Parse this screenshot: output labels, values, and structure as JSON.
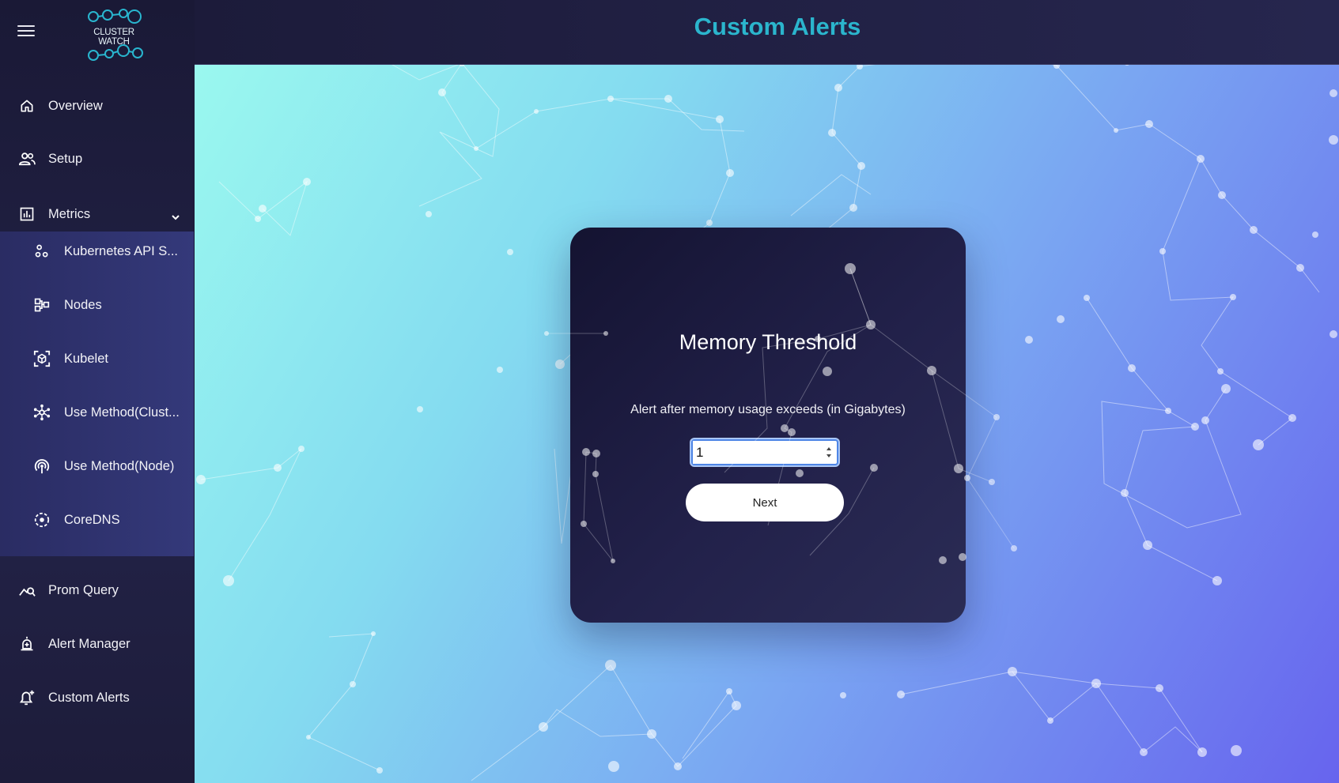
{
  "app": {
    "logo_text": "CLUSTER WATCH",
    "page_title": "Custom Alerts"
  },
  "sidebar": {
    "items": [
      {
        "label": "Overview",
        "icon": "home-icon"
      },
      {
        "label": "Setup",
        "icon": "users-icon"
      },
      {
        "label": "Metrics",
        "icon": "bar-chart-icon"
      },
      {
        "label": "Prom Query",
        "icon": "query-chart-icon"
      },
      {
        "label": "Alert Manager",
        "icon": "alarm-icon"
      },
      {
        "label": "Custom Alerts",
        "icon": "add-alert-icon"
      }
    ],
    "metrics_sub": [
      {
        "label": "Kubernetes API S...",
        "icon": "hub-icon"
      },
      {
        "label": "Nodes",
        "icon": "schema-icon"
      },
      {
        "label": "Kubelet",
        "icon": "cube-scan-icon"
      },
      {
        "label": "Use Method(Clust...",
        "icon": "network-hub-icon"
      },
      {
        "label": "Use Method(Node)",
        "icon": "wireless-icon"
      },
      {
        "label": "CoreDNS",
        "icon": "dashed-circle-icon"
      }
    ]
  },
  "card": {
    "title": "Memory Threshold",
    "description": "Alert after memory usage exceeds (in Gigabytes)",
    "input_value": "1",
    "button_label": "Next"
  },
  "colors": {
    "accent": "#2bb5cd",
    "sidebar_bg": "#1a1936",
    "submenu_bg": "#2f3270",
    "card_bg": "#1b1a3d",
    "gradient_start": "#9af8ef",
    "gradient_end": "#6764ee"
  }
}
